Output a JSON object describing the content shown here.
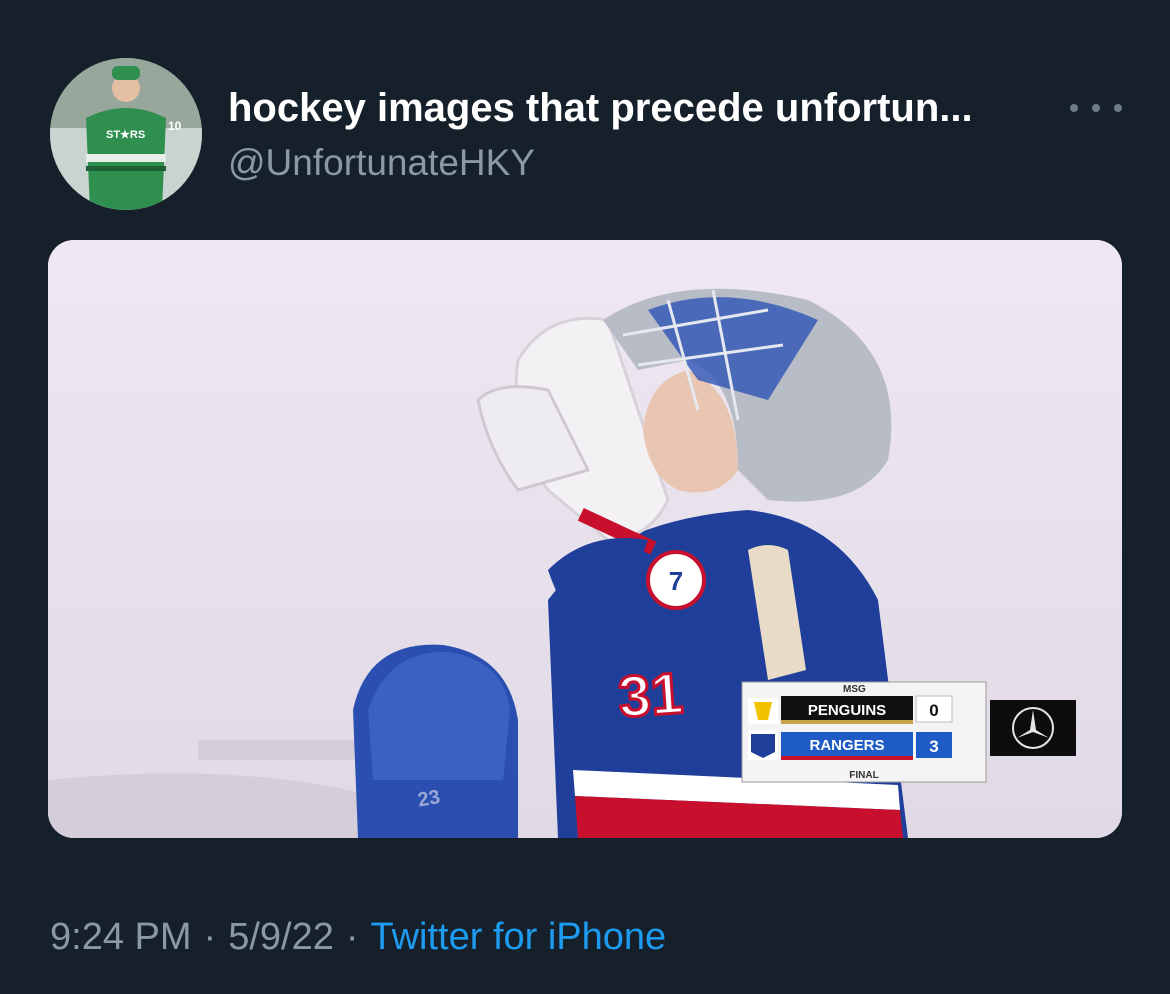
{
  "tweet": {
    "display_name": "hockey images that precede unfortun...",
    "handle": "@UnfortunateHKY",
    "time": "9:24 PM",
    "date": "5/9/22",
    "source": "Twitter for iPhone",
    "separator": "·"
  },
  "avatar": {
    "jersey_text": "ST★RS",
    "number": "10"
  },
  "media": {
    "player_number": "31",
    "helmet_number": "23",
    "scorebug": {
      "network": "MSG",
      "team1": "PENGUINS",
      "score1": "0",
      "team2": "RANGERS",
      "score2": "3",
      "status": "FINAL"
    }
  },
  "colors": {
    "background": "#15202b",
    "secondary_text": "#8b98a5",
    "link": "#1d9bf0",
    "jersey_blue": "#1f3f9a",
    "jersey_red": "#c8102e"
  }
}
